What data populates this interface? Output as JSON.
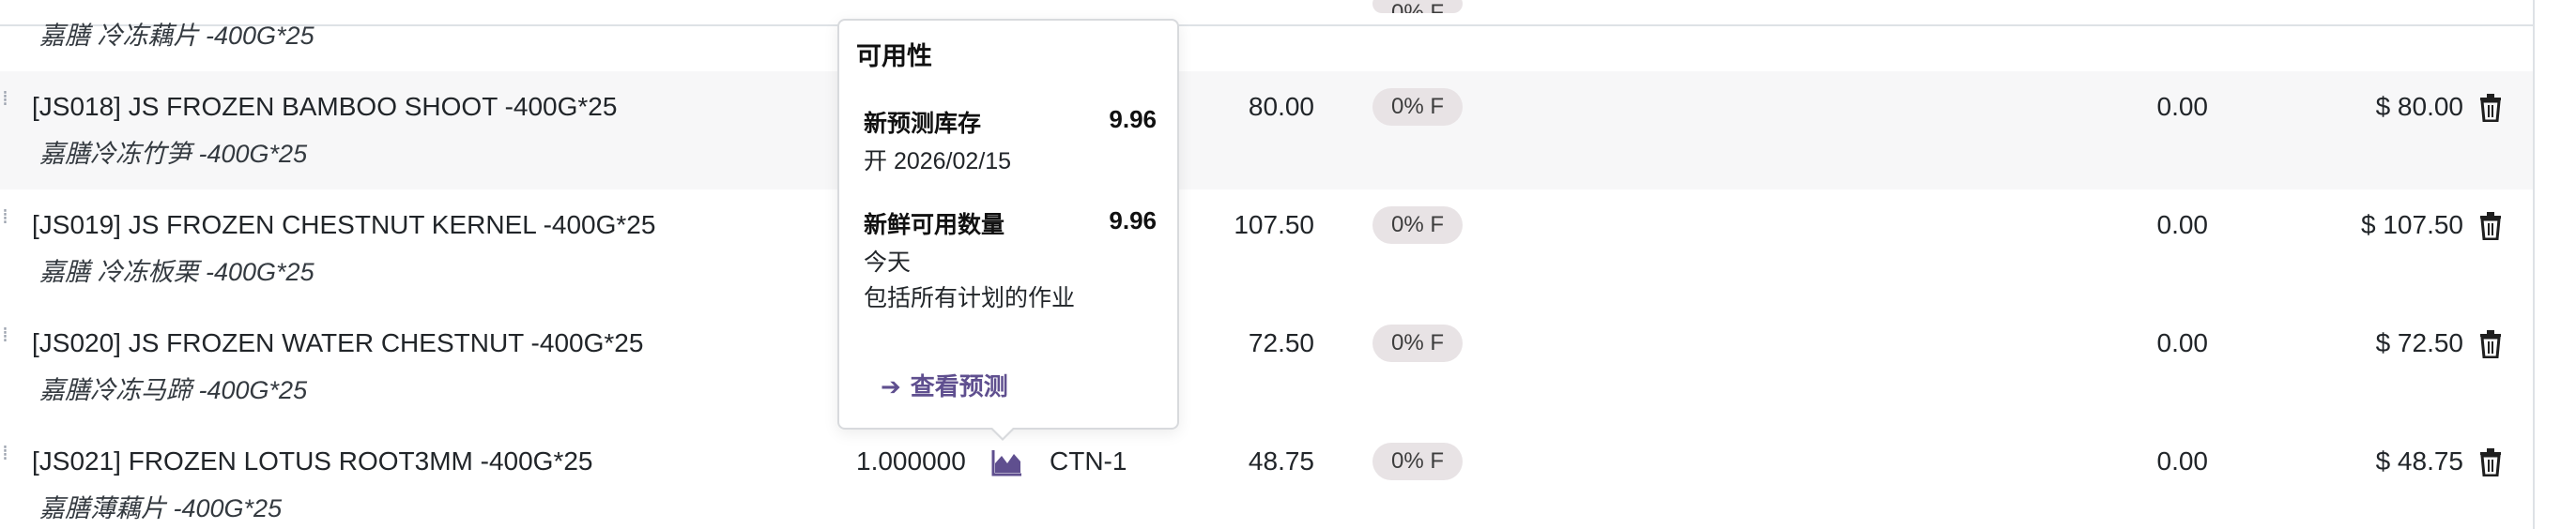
{
  "lines": [
    {
      "code_name": "",
      "description": "嘉膳 冷冻藕片 -400G*25",
      "qty": "",
      "uom": "",
      "price": "",
      "tax": "0% F",
      "discount": "",
      "subtotal": ""
    },
    {
      "code_name": "[JS018] JS FROZEN BAMBOO SHOOT -400G*25",
      "description": "嘉膳冷冻竹笋 -400G*25",
      "qty": "",
      "uom": "",
      "price": "80.00",
      "tax": "0% F",
      "discount": "0.00",
      "subtotal": "$ 80.00"
    },
    {
      "code_name": "[JS019] JS FROZEN CHESTNUT KERNEL -400G*25",
      "description": "嘉膳 冷冻板栗 -400G*25",
      "qty": "",
      "uom": "",
      "price": "107.50",
      "tax": "0% F",
      "discount": "0.00",
      "subtotal": "$ 107.50"
    },
    {
      "code_name": "[JS020] JS FROZEN WATER CHESTNUT -400G*25",
      "description": "嘉膳冷冻马蹄 -400G*25",
      "qty": "",
      "uom": "",
      "price": "72.50",
      "tax": "0% F",
      "discount": "0.00",
      "subtotal": "$ 72.50"
    },
    {
      "code_name": "[JS021] FROZEN LOTUS ROOT3MM -400G*25",
      "description": "嘉膳薄藕片 -400G*25",
      "qty": "1.000000",
      "uom": "CTN-1",
      "price": "48.75",
      "tax": "0% F",
      "discount": "0.00",
      "subtotal": "$ 48.75"
    }
  ],
  "popover": {
    "title": "可用性",
    "forecast_label": "新预测库存",
    "forecast_value": "9.96",
    "forecast_date": "开 2026/02/15",
    "free_label": "新鲜可用数量",
    "free_value": "9.96",
    "free_when": "今天",
    "free_note": "包括所有计划的作业",
    "link_label": "查看预测"
  },
  "colors": {
    "accent": "#5f4f8f",
    "badge_bg": "#e8e3e5",
    "row_border": "#dee2e6",
    "hover_row": "#f7f7f8"
  },
  "icons": {
    "drag": "drag-handle-icon",
    "forecast": "area-chart-icon",
    "delete": "trash-icon",
    "link_arrow": "arrow-right-icon"
  }
}
